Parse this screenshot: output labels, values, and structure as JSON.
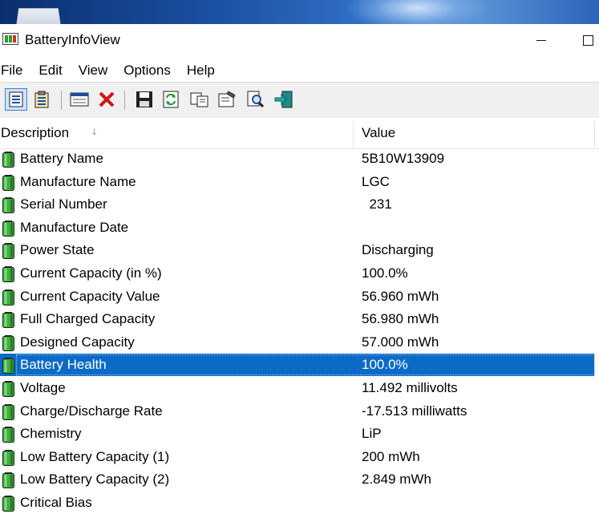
{
  "window": {
    "title": "BatteryInfoView",
    "app_icon": "battery-app-icon",
    "controls": [
      "minimize-icon",
      "maximize-icon"
    ]
  },
  "menu": [
    "File",
    "Edit",
    "View",
    "Options",
    "Help"
  ],
  "toolbar": {
    "icons": [
      "html-report-icon",
      "log-view-icon",
      "properties-window-icon",
      "delete-icon",
      "save-icon",
      "refresh-icon",
      "copy-icon",
      "properties-icon",
      "find-icon",
      "exit-icon"
    ]
  },
  "table": {
    "columns": [
      "Description",
      "Value"
    ],
    "sort_indicator": "↓",
    "selected_index": 9,
    "rows": [
      {
        "description": "Battery Name",
        "value": "5B10W13909"
      },
      {
        "description": "Manufacture Name",
        "value": "LGC"
      },
      {
        "description": "Serial Number",
        "value": "  231"
      },
      {
        "description": "Manufacture Date",
        "value": ""
      },
      {
        "description": "Power State",
        "value": "Discharging"
      },
      {
        "description": "Current Capacity (in %)",
        "value": "100.0%"
      },
      {
        "description": "Current Capacity Value",
        "value": "56.960 mWh"
      },
      {
        "description": "Full Charged Capacity",
        "value": "56.980 mWh"
      },
      {
        "description": "Designed Capacity",
        "value": "57.000 mWh"
      },
      {
        "description": "Battery Health",
        "value": "100.0%"
      },
      {
        "description": "Voltage",
        "value": "11.492 millivolts"
      },
      {
        "description": "Charge/Discharge Rate",
        "value": "-17.513 milliwatts"
      },
      {
        "description": "Chemistry",
        "value": "LiP"
      },
      {
        "description": "Low Battery Capacity (1)",
        "value": "200 mWh"
      },
      {
        "description": "Low Battery Capacity (2)",
        "value": "2.849 mWh"
      },
      {
        "description": "Critical Bias",
        "value": ""
      }
    ]
  },
  "colors": {
    "selection": "#0d6bc8",
    "battery_green": "#3a9a3a",
    "toolbar_bg": "#f0f0f0"
  }
}
